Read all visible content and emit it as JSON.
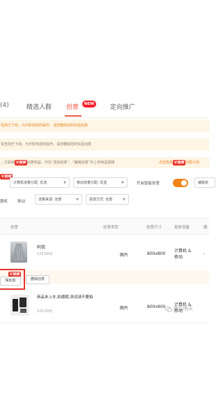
{
  "tabs": [
    {
      "label": "(4)"
    },
    {
      "label": "精选人群"
    },
    {
      "label": "创意",
      "badge": "NEW",
      "active": true
    },
    {
      "label": "定向推广"
    }
  ],
  "notices": {
    "line1": "告前已下线，为不影响您的操作，请您删除您的实验创意",
    "line2": "实告前已下线，为不影响您的操作，请您删除您的实验创意",
    "line3_text": "，已获得",
    "line3_tag": "V视频",
    "line3_mid": "创意权益，可在“添加创意”、“编辑创意”中上传商品视频",
    "line3_right_prefix": "点击查看",
    "line3_right_tag": "V视频",
    "line3_right_suffix": "创意计划"
  },
  "filters": {
    "vtag": "V视频",
    "traffic_label": "计算机流量分配: 优选",
    "mobile_label": "移动流量分配: 优选",
    "smart_label": "开启智能创意",
    "smart_on": true,
    "edit_button": "编辑资",
    "device_pc": "算机",
    "device_mobile": "移动",
    "source_label": "流量来源: 全部",
    "delivery_label": "投放方式: 全部"
  },
  "table": {
    "headers": [
      "创意",
      "创意类型",
      "创意尺寸",
      "投放设备",
      "展"
    ],
    "rows": [
      {
        "title": "阿我",
        "price": "123.00元",
        "type": "图片",
        "size": "800x800",
        "devices": "计算机 &\n移动",
        "extra": "-"
      },
      {
        "title": "新品未上车,拍德戳,测试请不要拍",
        "price": "123.00元",
        "type": "图片",
        "size": "800x800",
        "devices": "计算机 &\n移动",
        "extra": ""
      }
    ],
    "row_actions": {
      "vtag": "V视频",
      "edit": "辑创意",
      "delete": "删除创意"
    }
  },
  "watermark": "南后哨天",
  "colors": {
    "accent": "#f05a4a",
    "notice_bg": "#fff5e6",
    "toggle": "#f08418",
    "highlight_border": "#e8342b"
  }
}
